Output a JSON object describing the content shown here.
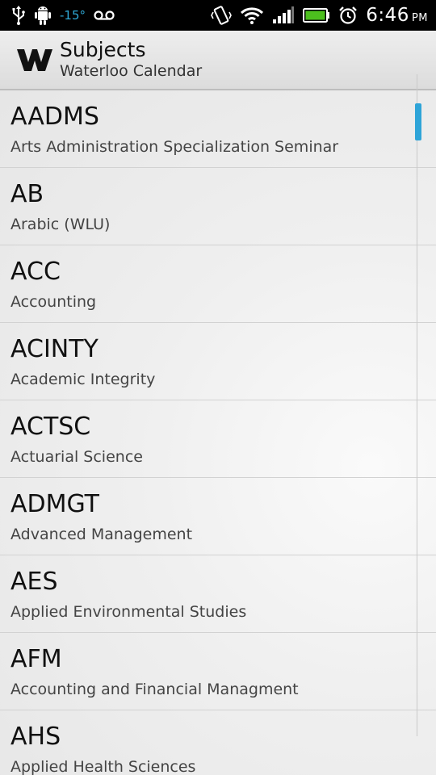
{
  "status_bar": {
    "temperature": "-15°",
    "time": "6:46",
    "ampm": "PM"
  },
  "action_bar": {
    "title": "Subjects",
    "subtitle": "Waterloo Calendar"
  },
  "subjects": [
    {
      "code": "AADMS",
      "name": "Arts Administration Specialization Seminar"
    },
    {
      "code": "AB",
      "name": "Arabic (WLU)"
    },
    {
      "code": "ACC",
      "name": "Accounting"
    },
    {
      "code": "ACINTY",
      "name": "Academic Integrity"
    },
    {
      "code": "ACTSC",
      "name": "Actuarial Science"
    },
    {
      "code": "ADMGT",
      "name": "Advanced Management"
    },
    {
      "code": "AES",
      "name": "Applied Environmental Studies"
    },
    {
      "code": "AFM",
      "name": "Accounting and Financial Managment"
    },
    {
      "code": "AHS",
      "name": "Applied Health Sciences"
    }
  ],
  "colors": {
    "accent": "#2ea4d8",
    "status_bar": "#000000"
  }
}
